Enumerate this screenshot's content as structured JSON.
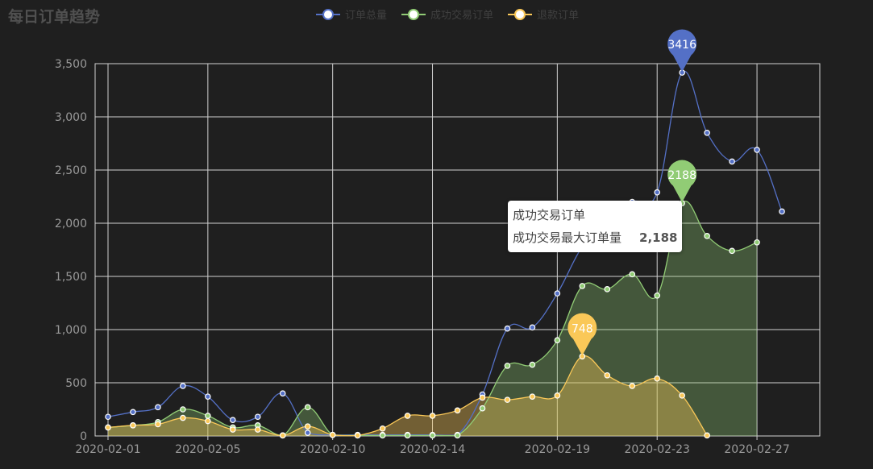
{
  "title": "每日订单趋势",
  "colors": {
    "total": "#5470c6",
    "success": "#91cc75",
    "refund": "#fac858",
    "grid": "#d0d0d0",
    "axis_text": "#9a9a9a"
  },
  "tooltip": {
    "series": "成功交易订单",
    "label": "成功交易最大订单量",
    "value": "2,188"
  },
  "chart_data": {
    "type": "line",
    "title": "每日订单趋势",
    "x": [
      "2020-02-01",
      "2020-02-02",
      "2020-02-03",
      "2020-02-04",
      "2020-02-05",
      "2020-02-06",
      "2020-02-07",
      "2020-02-08",
      "2020-02-09",
      "2020-02-10",
      "2020-02-11",
      "2020-02-12",
      "2020-02-13",
      "2020-02-14",
      "2020-02-15",
      "2020-02-16",
      "2020-02-17",
      "2020-02-18",
      "2020-02-19",
      "2020-02-20",
      "2020-02-21",
      "2020-02-22",
      "2020-02-23",
      "2020-02-24",
      "2020-02-25",
      "2020-02-26",
      "2020-02-27",
      "2020-02-28",
      "2020-02-29"
    ],
    "x_tick_labels": [
      "2020-02-01",
      "2020-02-05",
      "2020-02-10",
      "2020-02-14",
      "2020-02-19",
      "2020-02-23",
      "2020-02-27"
    ],
    "y_tick_labels": [
      "0",
      "500",
      "1,000",
      "1,500",
      "2,000",
      "2,500",
      "3,000",
      "3,500"
    ],
    "ylim": [
      0,
      3500
    ],
    "grid": true,
    "legend_position": "top-center",
    "series": [
      {
        "name": "订单总量",
        "key": "total",
        "area": false,
        "values": [
          180,
          225,
          270,
          470,
          370,
          150,
          180,
          400,
          30,
          10,
          10,
          10,
          10,
          10,
          10,
          390,
          1010,
          1020,
          1340,
          1780,
          2020,
          2200,
          2290,
          3416,
          2850,
          2580,
          2690,
          2110,
          null
        ],
        "max_label": "3416"
      },
      {
        "name": "成功交易订单",
        "key": "success",
        "area": true,
        "values": [
          80,
          100,
          130,
          250,
          190,
          80,
          100,
          5,
          270,
          10,
          5,
          5,
          5,
          5,
          5,
          260,
          660,
          670,
          900,
          1410,
          1380,
          1520,
          1320,
          2188,
          1880,
          1740,
          1820,
          null,
          null
        ],
        "max_label": "2188"
      },
      {
        "name": "退款订单",
        "key": "refund",
        "area": true,
        "values": [
          80,
          100,
          110,
          170,
          140,
          60,
          60,
          5,
          90,
          10,
          5,
          70,
          190,
          190,
          240,
          360,
          340,
          370,
          380,
          748,
          570,
          470,
          540,
          380,
          5,
          null,
          null,
          null,
          null
        ],
        "max_label": "748"
      }
    ]
  }
}
